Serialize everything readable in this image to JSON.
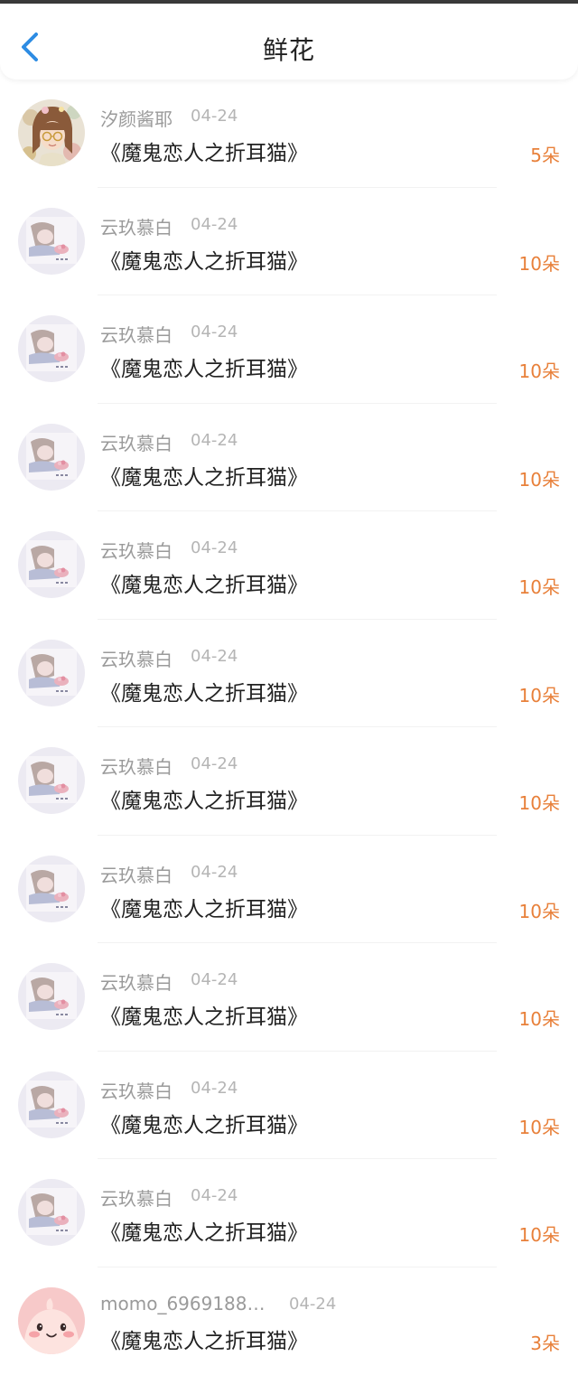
{
  "header": {
    "title": "鲜花",
    "back_icon": "chevron-left-icon",
    "accent": "#2d8ce3"
  },
  "colors": {
    "count": "#e8803a",
    "name": "#9a9a9a",
    "date": "#b5b5b5",
    "book": "#222222"
  },
  "items": [
    {
      "name": "汐颜酱耶",
      "date": "04-24",
      "book": "《魔鬼恋人之折耳猫》",
      "count": "5朵",
      "avatar": "anime-girl-glasses-avatar"
    },
    {
      "name": "云玖慕白",
      "date": "04-24",
      "book": "《魔鬼恋人之折耳猫》",
      "count": "10朵",
      "avatar": "lying-girl-avatar"
    },
    {
      "name": "云玖慕白",
      "date": "04-24",
      "book": "《魔鬼恋人之折耳猫》",
      "count": "10朵",
      "avatar": "lying-girl-avatar"
    },
    {
      "name": "云玖慕白",
      "date": "04-24",
      "book": "《魔鬼恋人之折耳猫》",
      "count": "10朵",
      "avatar": "lying-girl-avatar"
    },
    {
      "name": "云玖慕白",
      "date": "04-24",
      "book": "《魔鬼恋人之折耳猫》",
      "count": "10朵",
      "avatar": "lying-girl-avatar"
    },
    {
      "name": "云玖慕白",
      "date": "04-24",
      "book": "《魔鬼恋人之折耳猫》",
      "count": "10朵",
      "avatar": "lying-girl-avatar"
    },
    {
      "name": "云玖慕白",
      "date": "04-24",
      "book": "《魔鬼恋人之折耳猫》",
      "count": "10朵",
      "avatar": "lying-girl-avatar"
    },
    {
      "name": "云玖慕白",
      "date": "04-24",
      "book": "《魔鬼恋人之折耳猫》",
      "count": "10朵",
      "avatar": "lying-girl-avatar"
    },
    {
      "name": "云玖慕白",
      "date": "04-24",
      "book": "《魔鬼恋人之折耳猫》",
      "count": "10朵",
      "avatar": "lying-girl-avatar"
    },
    {
      "name": "云玖慕白",
      "date": "04-24",
      "book": "《魔鬼恋人之折耳猫》",
      "count": "10朵",
      "avatar": "lying-girl-avatar"
    },
    {
      "name": "云玖慕白",
      "date": "04-24",
      "book": "《魔鬼恋人之折耳猫》",
      "count": "10朵",
      "avatar": "lying-girl-avatar"
    },
    {
      "name": "momo_69691884...",
      "date": "04-24",
      "book": "《魔鬼恋人之折耳猫》",
      "count": "3朵",
      "avatar": "pink-blob-avatar"
    }
  ]
}
